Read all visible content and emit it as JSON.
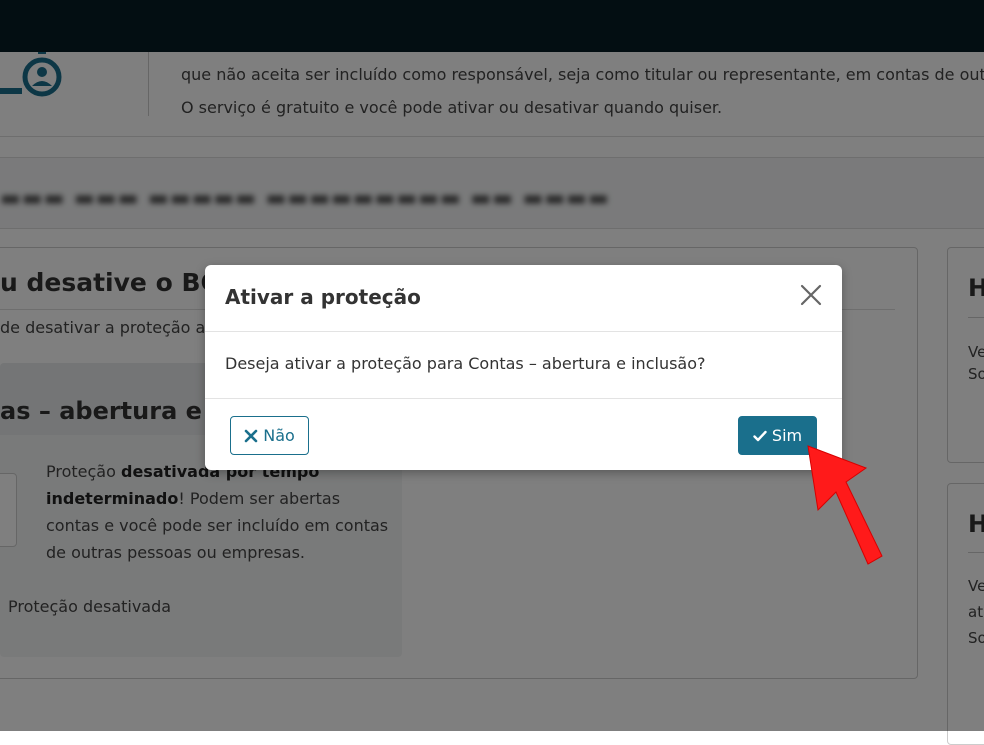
{
  "header": {
    "line1": "que não aceita ser incluído como responsável, seja como titular ou representante, em contas de outras",
    "line2": "O serviço é gratuito e você pode ativar ou desativar quando quiser."
  },
  "page": {
    "section_title": "u desative o BC Pro",
    "section_subtitle": "de desativar a proteção a",
    "panel_title": "as – abertura e inc",
    "description_pre": "Proteção ",
    "description_bold1": "desativada por tempo",
    "description_bold2": "indeterminado",
    "description_post": "! Podem ser abertas contas e você pode ser incluído em contas de outras pessoas ou empresas.",
    "status": "Proteção desativada"
  },
  "sidebar_cards": [
    {
      "heading": "H",
      "lines": [
        "Ve",
        "So"
      ]
    },
    {
      "heading": "H",
      "lines": [
        "Ve",
        "at",
        "So"
      ]
    }
  ],
  "modal": {
    "title": "Ativar a proteção",
    "message": "Deseja ativar a proteção para Contas – abertura e inclusão?",
    "no_label": "Não",
    "yes_label": "Sim"
  },
  "icons": {
    "close": "close-icon",
    "no": "x-icon",
    "yes": "check-icon",
    "pointer": "red-arrow-icon"
  },
  "colors": {
    "primary": "#1a6f8c",
    "topbar": "#061c24",
    "arrow": "#ff1a1a"
  }
}
